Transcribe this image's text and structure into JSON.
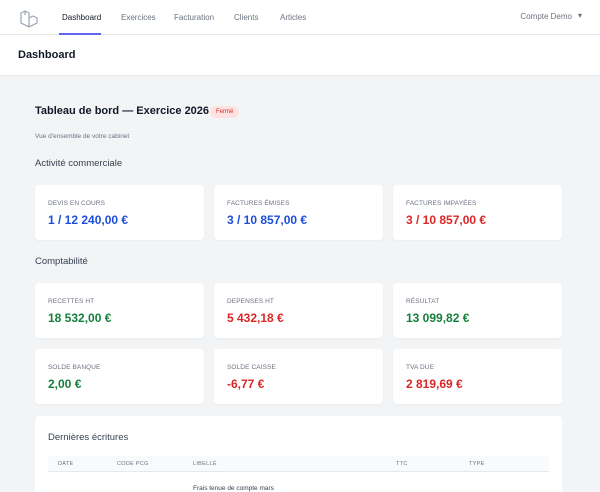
{
  "nav": {
    "links": [
      "Dashboard",
      "Exercices",
      "Facturation",
      "Clients",
      "Articles"
    ],
    "account": "Compte Demo"
  },
  "header": {
    "title": "Dashboard"
  },
  "summary": {
    "title": "Tableau de bord — Exercice 2026",
    "status": "Fermé",
    "subtitle": "Vue d'ensemble de votre cabinet"
  },
  "sections": {
    "commercial": "Activité commerciale",
    "accounting": "Comptabilité"
  },
  "cards_commercial": [
    {
      "label": "DEVIS EN COURS",
      "value": "1 / 12 240,00 €",
      "color": "#1d4ed8"
    },
    {
      "label": "FACTURES ÉMISES",
      "value": "3 / 10 857,00 €",
      "color": "#1d4ed8"
    },
    {
      "label": "FACTURES IMPAYÉES",
      "value": "3 / 10 857,00 €",
      "color": "#dc2626"
    }
  ],
  "cards_accounting": [
    {
      "label": "RECETTES HT",
      "value": "18 532,00 €",
      "color": "#15803d"
    },
    {
      "label": "DEPENSES HT",
      "value": "5 432,18 €",
      "color": "#dc2626"
    },
    {
      "label": "RÉSULTAT",
      "value": "13 099,82 €",
      "color": "#15803d"
    },
    {
      "label": "SOLDE BANQUE",
      "value": "2,00 €",
      "color": "#15803d"
    },
    {
      "label": "SOLDE CAISSE",
      "value": "-6,77 €",
      "color": "#dc2626"
    },
    {
      "label": "TVA DUE",
      "value": "2 819,69 €",
      "color": "#dc2626"
    }
  ],
  "recent": {
    "title": "Dernières écritures",
    "columns": [
      "DATE",
      "CODE PCG",
      "LIBELLÉ",
      "TTC",
      "TYPE"
    ],
    "rows": [
      {
        "label": "Frais tenue de compte mars"
      }
    ]
  }
}
